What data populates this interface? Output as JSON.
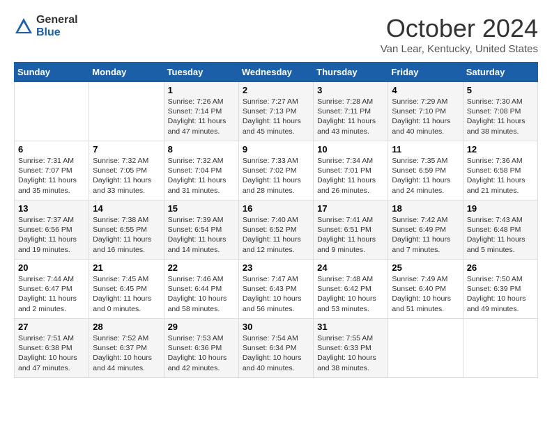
{
  "logo": {
    "general": "General",
    "blue": "Blue"
  },
  "title": "October 2024",
  "location": "Van Lear, Kentucky, United States",
  "weekdays": [
    "Sunday",
    "Monday",
    "Tuesday",
    "Wednesday",
    "Thursday",
    "Friday",
    "Saturday"
  ],
  "weeks": [
    [
      {
        "day": "",
        "info": ""
      },
      {
        "day": "",
        "info": ""
      },
      {
        "day": "1",
        "info": "Sunrise: 7:26 AM\nSunset: 7:14 PM\nDaylight: 11 hours and 47 minutes."
      },
      {
        "day": "2",
        "info": "Sunrise: 7:27 AM\nSunset: 7:13 PM\nDaylight: 11 hours and 45 minutes."
      },
      {
        "day": "3",
        "info": "Sunrise: 7:28 AM\nSunset: 7:11 PM\nDaylight: 11 hours and 43 minutes."
      },
      {
        "day": "4",
        "info": "Sunrise: 7:29 AM\nSunset: 7:10 PM\nDaylight: 11 hours and 40 minutes."
      },
      {
        "day": "5",
        "info": "Sunrise: 7:30 AM\nSunset: 7:08 PM\nDaylight: 11 hours and 38 minutes."
      }
    ],
    [
      {
        "day": "6",
        "info": "Sunrise: 7:31 AM\nSunset: 7:07 PM\nDaylight: 11 hours and 35 minutes."
      },
      {
        "day": "7",
        "info": "Sunrise: 7:32 AM\nSunset: 7:05 PM\nDaylight: 11 hours and 33 minutes."
      },
      {
        "day": "8",
        "info": "Sunrise: 7:32 AM\nSunset: 7:04 PM\nDaylight: 11 hours and 31 minutes."
      },
      {
        "day": "9",
        "info": "Sunrise: 7:33 AM\nSunset: 7:02 PM\nDaylight: 11 hours and 28 minutes."
      },
      {
        "day": "10",
        "info": "Sunrise: 7:34 AM\nSunset: 7:01 PM\nDaylight: 11 hours and 26 minutes."
      },
      {
        "day": "11",
        "info": "Sunrise: 7:35 AM\nSunset: 6:59 PM\nDaylight: 11 hours and 24 minutes."
      },
      {
        "day": "12",
        "info": "Sunrise: 7:36 AM\nSunset: 6:58 PM\nDaylight: 11 hours and 21 minutes."
      }
    ],
    [
      {
        "day": "13",
        "info": "Sunrise: 7:37 AM\nSunset: 6:56 PM\nDaylight: 11 hours and 19 minutes."
      },
      {
        "day": "14",
        "info": "Sunrise: 7:38 AM\nSunset: 6:55 PM\nDaylight: 11 hours and 16 minutes."
      },
      {
        "day": "15",
        "info": "Sunrise: 7:39 AM\nSunset: 6:54 PM\nDaylight: 11 hours and 14 minutes."
      },
      {
        "day": "16",
        "info": "Sunrise: 7:40 AM\nSunset: 6:52 PM\nDaylight: 11 hours and 12 minutes."
      },
      {
        "day": "17",
        "info": "Sunrise: 7:41 AM\nSunset: 6:51 PM\nDaylight: 11 hours and 9 minutes."
      },
      {
        "day": "18",
        "info": "Sunrise: 7:42 AM\nSunset: 6:49 PM\nDaylight: 11 hours and 7 minutes."
      },
      {
        "day": "19",
        "info": "Sunrise: 7:43 AM\nSunset: 6:48 PM\nDaylight: 11 hours and 5 minutes."
      }
    ],
    [
      {
        "day": "20",
        "info": "Sunrise: 7:44 AM\nSunset: 6:47 PM\nDaylight: 11 hours and 2 minutes."
      },
      {
        "day": "21",
        "info": "Sunrise: 7:45 AM\nSunset: 6:45 PM\nDaylight: 11 hours and 0 minutes."
      },
      {
        "day": "22",
        "info": "Sunrise: 7:46 AM\nSunset: 6:44 PM\nDaylight: 10 hours and 58 minutes."
      },
      {
        "day": "23",
        "info": "Sunrise: 7:47 AM\nSunset: 6:43 PM\nDaylight: 10 hours and 56 minutes."
      },
      {
        "day": "24",
        "info": "Sunrise: 7:48 AM\nSunset: 6:42 PM\nDaylight: 10 hours and 53 minutes."
      },
      {
        "day": "25",
        "info": "Sunrise: 7:49 AM\nSunset: 6:40 PM\nDaylight: 10 hours and 51 minutes."
      },
      {
        "day": "26",
        "info": "Sunrise: 7:50 AM\nSunset: 6:39 PM\nDaylight: 10 hours and 49 minutes."
      }
    ],
    [
      {
        "day": "27",
        "info": "Sunrise: 7:51 AM\nSunset: 6:38 PM\nDaylight: 10 hours and 47 minutes."
      },
      {
        "day": "28",
        "info": "Sunrise: 7:52 AM\nSunset: 6:37 PM\nDaylight: 10 hours and 44 minutes."
      },
      {
        "day": "29",
        "info": "Sunrise: 7:53 AM\nSunset: 6:36 PM\nDaylight: 10 hours and 42 minutes."
      },
      {
        "day": "30",
        "info": "Sunrise: 7:54 AM\nSunset: 6:34 PM\nDaylight: 10 hours and 40 minutes."
      },
      {
        "day": "31",
        "info": "Sunrise: 7:55 AM\nSunset: 6:33 PM\nDaylight: 10 hours and 38 minutes."
      },
      {
        "day": "",
        "info": ""
      },
      {
        "day": "",
        "info": ""
      }
    ]
  ]
}
